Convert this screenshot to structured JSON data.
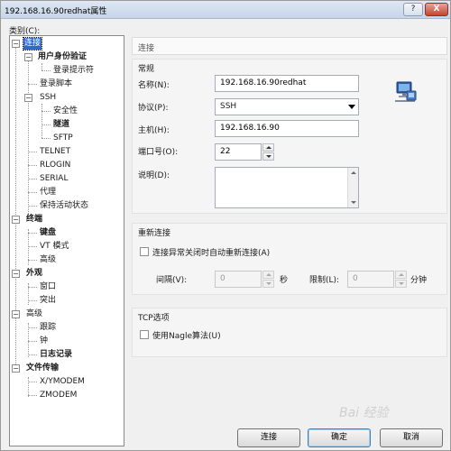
{
  "window": {
    "title": "192.168.16.90redhat属性",
    "help_label": "?",
    "close_label": "X"
  },
  "category_label": "类别(C):",
  "tree": {
    "connect": "连接",
    "user_auth": "用户身份验证",
    "login_prompt": "登录提示符",
    "login_script": "登录脚本",
    "ssh": "SSH",
    "security": "安全性",
    "tunnel": "隧道",
    "sftp": "SFTP",
    "telnet": "TELNET",
    "rlogin": "RLOGIN",
    "serial": "SERIAL",
    "proxy": "代理",
    "keepalive": "保持活动状态",
    "terminal": "终端",
    "keyboard": "键盘",
    "vt_mode": "VT 模式",
    "term_advanced": "高级",
    "appearance": "外观",
    "window_node": "窗口",
    "highlight": "突出",
    "advanced": "高级",
    "trace": "跟踪",
    "bell": "钟",
    "logging": "日志记录",
    "file_transfer": "文件传输",
    "xymodem": "X/YMODEM",
    "zmodem": "ZMODEM"
  },
  "header": {
    "title": "连接"
  },
  "general": {
    "section_title": "常规",
    "name_label": "名称(N):",
    "name_value": "192.168.16.90redhat",
    "protocol_label": "协议(P):",
    "protocol_value": "SSH",
    "host_label": "主机(H):",
    "host_value": "192.168.16.90",
    "port_label": "端口号(O):",
    "port_value": "22",
    "desc_label": "说明(D):",
    "desc_value": ""
  },
  "reconnect": {
    "section_title": "重新连接",
    "auto_reconnect_label": "连接异常关闭时自动重新连接(A)",
    "auto_reconnect_checked": false,
    "interval_label": "间隔(V):",
    "interval_value": "0",
    "seconds_unit": "秒",
    "limit_label": "限制(L):",
    "limit_value": "0",
    "minutes_unit": "分钟"
  },
  "tcp": {
    "section_title": "TCP选项",
    "nagle_label": "使用Nagle算法(U)",
    "nagle_checked": false
  },
  "buttons": {
    "connect": "连接",
    "ok": "确定",
    "cancel": "取消"
  },
  "watermark": "Bai 经验",
  "icons": {
    "toggle_expanded": "−",
    "network_icon": "network-computer-icon"
  }
}
